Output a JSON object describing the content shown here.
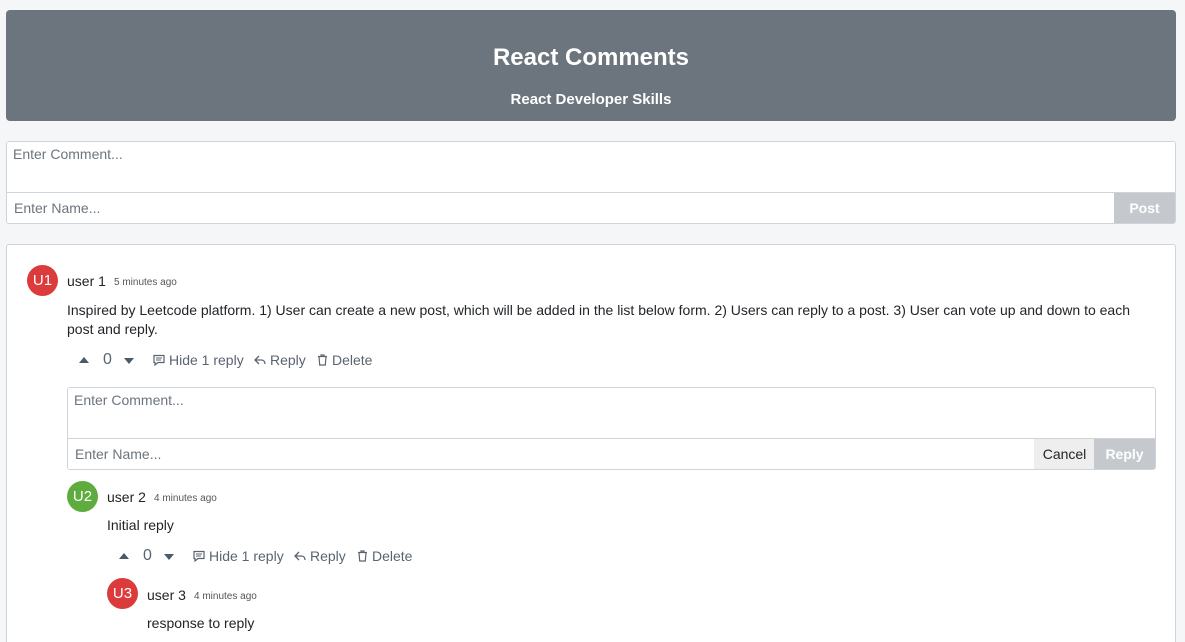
{
  "header": {
    "title": "React Comments",
    "subtitle": "React Developer Skills"
  },
  "main_form": {
    "comment_placeholder": "Enter Comment...",
    "name_placeholder": "Enter Name...",
    "post_label": "Post"
  },
  "comments": [
    {
      "initials": "U1",
      "avatar_color": "#dc3b3b",
      "user": "user 1",
      "time": "5 minutes ago",
      "text": "Inspired by Leetcode platform. 1) User can create a new post, which will be added in the list below form. 2) Users can reply to a post. 3) User can vote up and down to each post and reply.",
      "votes": "0",
      "toggle_label": "Hide 1 reply",
      "reply_label": "Reply",
      "delete_label": "Delete",
      "reply_form": {
        "comment_placeholder": "Enter Comment...",
        "name_placeholder": "Enter Name...",
        "cancel_label": "Cancel",
        "reply_label": "Reply"
      }
    },
    {
      "initials": "U2",
      "avatar_color": "#5fac3e",
      "user": "user 2",
      "time": "4 minutes ago",
      "text": "Initial reply",
      "votes": "0",
      "toggle_label": "Hide 1 reply",
      "reply_label": "Reply",
      "delete_label": "Delete"
    },
    {
      "initials": "U3",
      "avatar_color": "#dc3b3b",
      "user": "user 3",
      "time": "4 minutes ago",
      "text": "response to reply"
    }
  ],
  "icons": {
    "upvote": "caret-up-icon",
    "downvote": "caret-down-icon",
    "toggle": "comment-icon",
    "reply": "reply-icon",
    "delete": "trash-icon"
  }
}
